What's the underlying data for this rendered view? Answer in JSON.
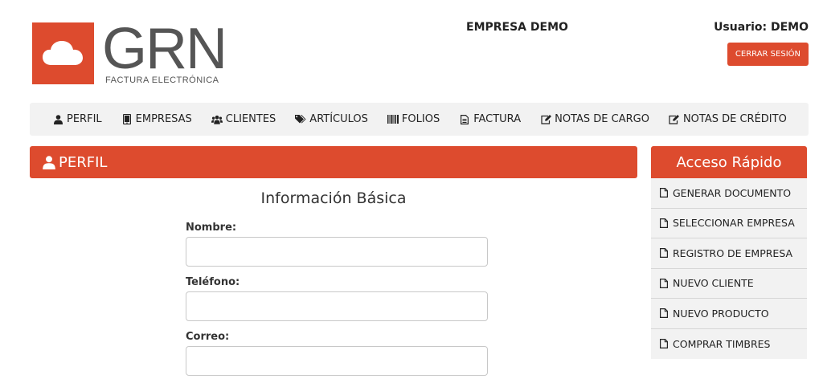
{
  "brand": {
    "logo_text": "GRN",
    "tagline": "FACTURA ELECTRÓNICA",
    "color": "#dd4b2e"
  },
  "header": {
    "company": "EMPRESA DEMO",
    "user": "Usuario: DEMO",
    "logout_label": "CERRAR SESIÓN"
  },
  "nav": {
    "items": [
      {
        "label": "PERFIL",
        "icon": "user-icon"
      },
      {
        "label": "EMPRESAS",
        "icon": "tablet-icon"
      },
      {
        "label": "CLIENTES",
        "icon": "users-icon"
      },
      {
        "label": "ARTÍCULOS",
        "icon": "tags-icon"
      },
      {
        "label": "FOLIOS",
        "icon": "barcode-icon"
      },
      {
        "label": "FACTURA",
        "icon": "file-text-icon"
      },
      {
        "label": "NOTAS DE CARGO",
        "icon": "edit-icon"
      },
      {
        "label": "NOTAS DE CRÉDITO",
        "icon": "edit-icon"
      }
    ]
  },
  "panel": {
    "title": "PERFIL",
    "form_title": "Información Básica",
    "fields": [
      {
        "label": "Nombre:",
        "value": ""
      },
      {
        "label": "Teléfono:",
        "value": ""
      },
      {
        "label": "Correo:",
        "value": ""
      }
    ]
  },
  "sidebar": {
    "title": "Acceso Rápido",
    "items": [
      {
        "label": "GENERAR DOCUMENTO"
      },
      {
        "label": "SELECCIONAR EMPRESA"
      },
      {
        "label": "REGISTRO DE EMPRESA"
      },
      {
        "label": "NUEVO CLIENTE"
      },
      {
        "label": "NUEVO PRODUCTO"
      },
      {
        "label": "COMPRAR TIMBRES"
      }
    ]
  }
}
